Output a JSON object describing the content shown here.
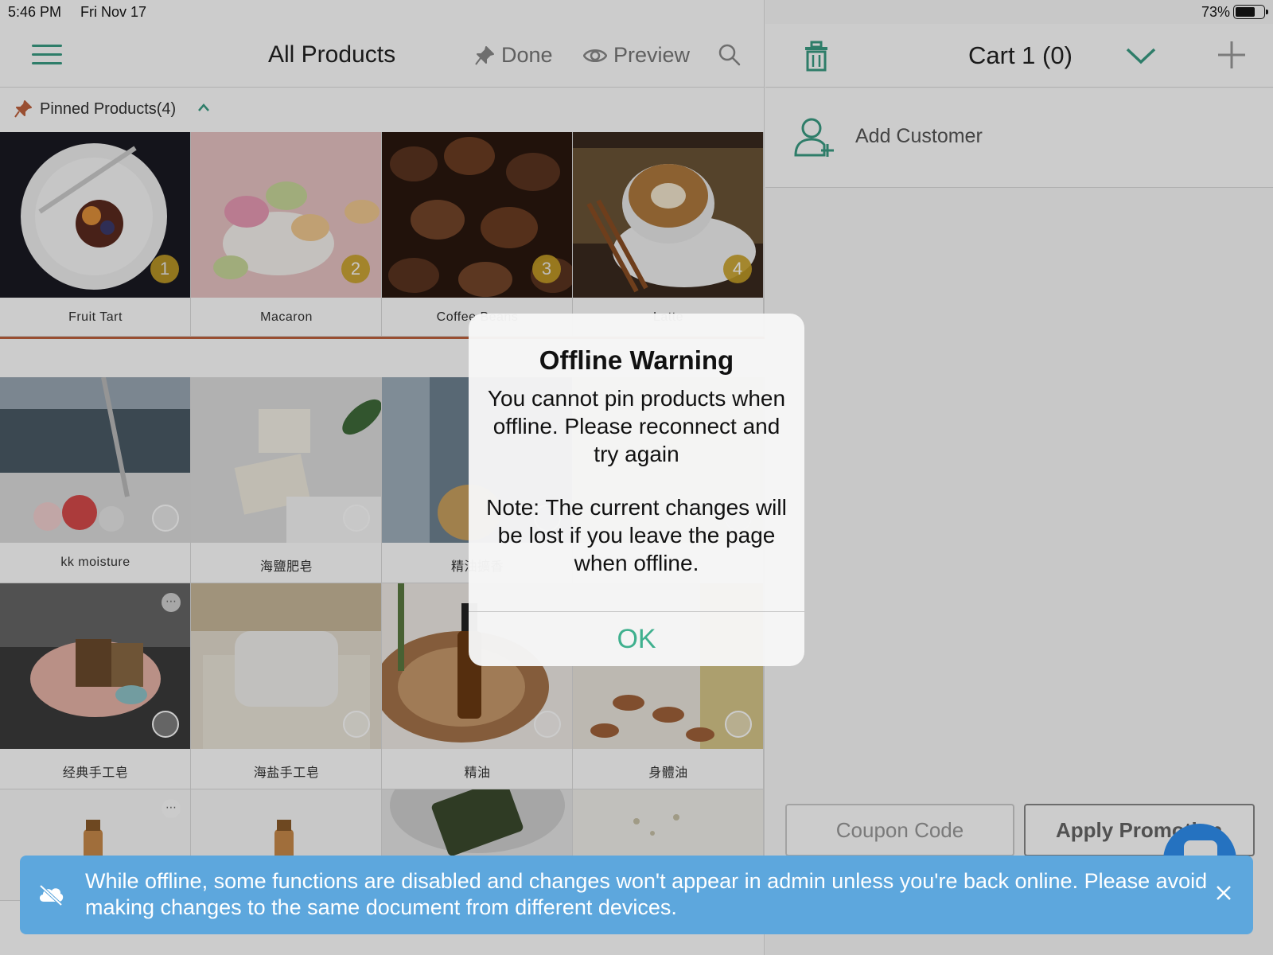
{
  "status_bar": {
    "time": "5:46 PM",
    "date": "Fri Nov 17",
    "battery_pct": "73%",
    "battery_level": 0.73
  },
  "header": {
    "title": "All Products",
    "done_label": "Done",
    "preview_label": "Preview",
    "menu_icon": "hamburger-icon",
    "search_icon": "search-icon"
  },
  "pinned": {
    "label": "Pinned Products(4)"
  },
  "pinned_products": [
    {
      "name": "Fruit Tart",
      "badge": "1"
    },
    {
      "name": "Macaron",
      "badge": "2"
    },
    {
      "name": "Coffee Beans",
      "badge": "3"
    },
    {
      "name": "Latte",
      "badge": "4"
    }
  ],
  "products": [
    {
      "name": "kk moisture"
    },
    {
      "name": "海鹽肥皂"
    },
    {
      "name": "精油擴香"
    },
    {
      "name": ""
    },
    {
      "name": "经典手工皂"
    },
    {
      "name": "海盐手工皂"
    },
    {
      "name": "精油"
    },
    {
      "name": "身體油"
    }
  ],
  "cart": {
    "title": "Cart 1 (0)",
    "add_customer": "Add Customer",
    "coupon_placeholder": "Coupon Code",
    "apply_label": "Apply Promotion"
  },
  "modal": {
    "title": "Offline Warning",
    "message": "You cannot pin products when offline. Please reconnect and try again",
    "note": "Note: The current changes will be lost if you leave the page when offline.",
    "ok_label": "OK"
  },
  "banner": {
    "text": "While offline, some functions are disabled and changes won't appear in admin unless you're back online. Please avoid making changes to the same document from different devices.",
    "icon": "cloud-offline-icon"
  },
  "colors": {
    "accent": "#3a9d84",
    "pin": "#c0623e",
    "badge": "#c9a227",
    "banner": "#5da7dd",
    "ok": "#3fb08e"
  }
}
